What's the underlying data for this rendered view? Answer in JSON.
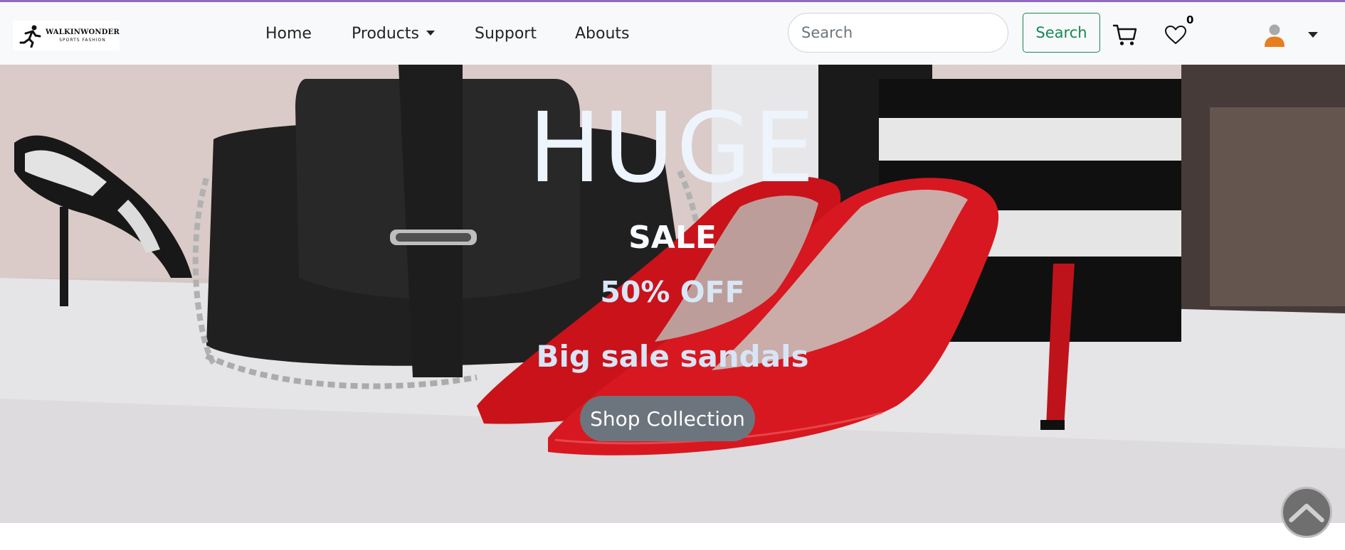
{
  "brand": {
    "name": "WALKINWONDER",
    "tagline": "SPORTS FASHION"
  },
  "nav": {
    "home": "Home",
    "products": "Products",
    "support": "Support",
    "abouts": "Abouts"
  },
  "search": {
    "placeholder": "Search",
    "button_label": "Search"
  },
  "wishlist": {
    "count": "0"
  },
  "hero": {
    "headline": "HUGE",
    "subheadline": "SALE",
    "discount": "50% OFF",
    "tagline": "Big sale sandals",
    "cta_label": "Shop Collection"
  },
  "icons": {
    "cart": "cart-icon",
    "wishlist": "heart-icon",
    "account": "user-avatar-icon",
    "scroll_top": "chevron-up-icon"
  },
  "colors": {
    "accent_line": "#8e6bbf",
    "search_button": "#198754",
    "cta_background": "#6c757d",
    "avatar": "#e87d1e"
  }
}
